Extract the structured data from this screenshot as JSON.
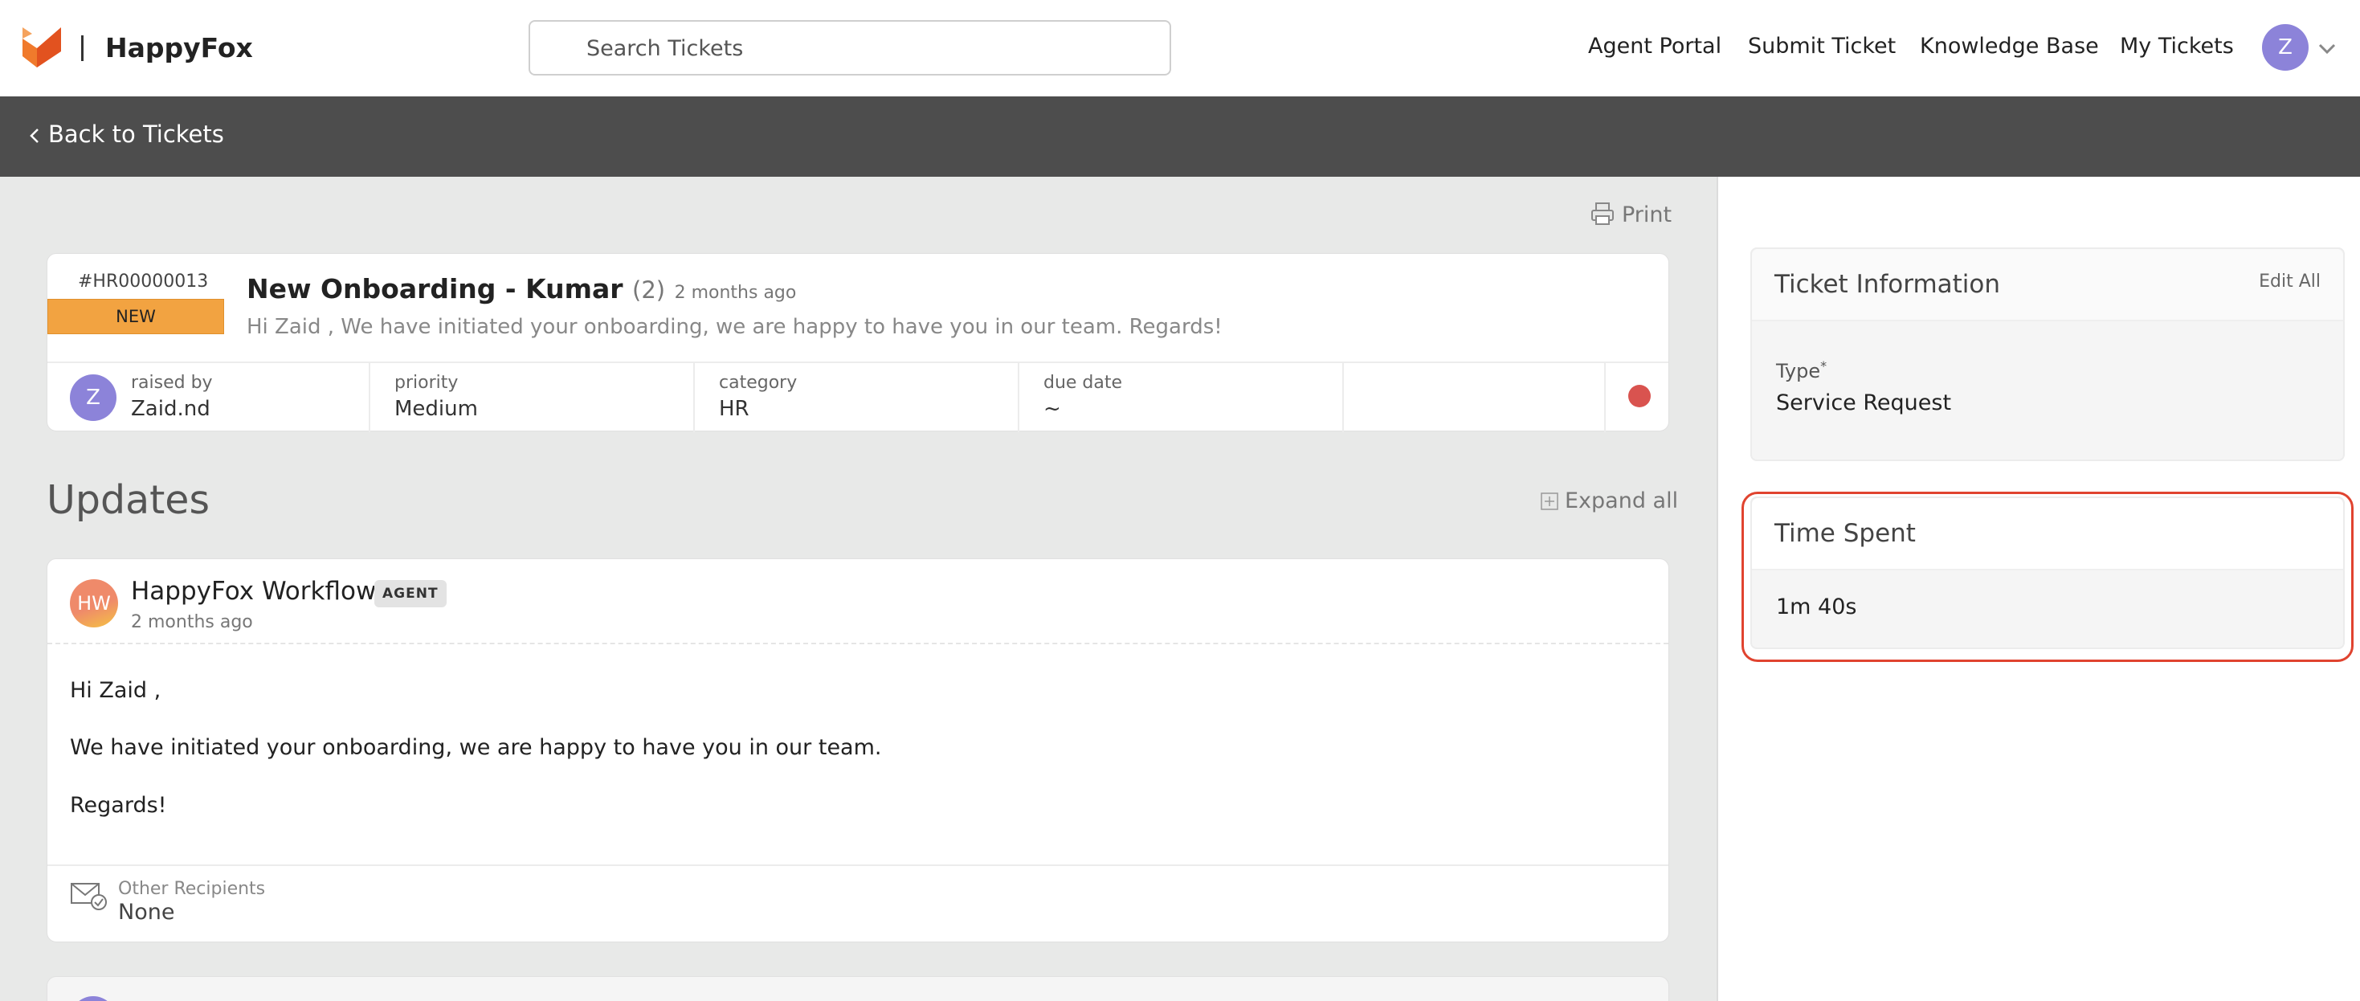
{
  "header": {
    "brand": "HappyFox",
    "search_placeholder": "Search Tickets",
    "nav": [
      "Agent Portal",
      "Submit Ticket",
      "Knowledge Base",
      "My Tickets"
    ],
    "user_initial": "Z"
  },
  "subheader": {
    "back_label": "Back to Tickets"
  },
  "print_label": "Print",
  "ticket": {
    "id": "#HR00000013",
    "status": "NEW",
    "title": "New Onboarding - Kumar",
    "count": "(2)",
    "time": "2 months ago",
    "preview": "Hi Zaid , We have initiated your onboarding, we are happy to have you in our team. Regards!",
    "meta": {
      "raised_by_label": "raised by",
      "raised_by_value": "Zaid.nd",
      "raised_by_initial": "Z",
      "priority_label": "priority",
      "priority_value": "Medium",
      "category_label": "category",
      "category_value": "HR",
      "due_label": "due date",
      "due_value": "~"
    },
    "status_dot_color": "#d9534f"
  },
  "updates": {
    "title": "Updates",
    "expand_label": "Expand all",
    "items": [
      {
        "initials": "HW",
        "author": "HappyFox Workflows",
        "badge": "AGENT",
        "time": "2 months ago",
        "body": [
          "Hi Zaid ,",
          "We have initiated your onboarding, we are happy to have you in our team.",
          "Regards!"
        ],
        "recipients_label": "Other Recipients",
        "recipients_value": "None"
      }
    ]
  },
  "sidebar": {
    "ticket_info": {
      "title": "Ticket Information",
      "edit_label": "Edit All",
      "type_label": "Type",
      "required_mark": "*",
      "type_value": "Service Request"
    },
    "time_spent": {
      "title": "Time Spent",
      "value": "1m 40s"
    }
  },
  "colors": {
    "brand_orange": "#f07a2c",
    "status_new": "#f2a341",
    "dark_bar": "#4d4d4d",
    "highlight": "#e0432f"
  }
}
